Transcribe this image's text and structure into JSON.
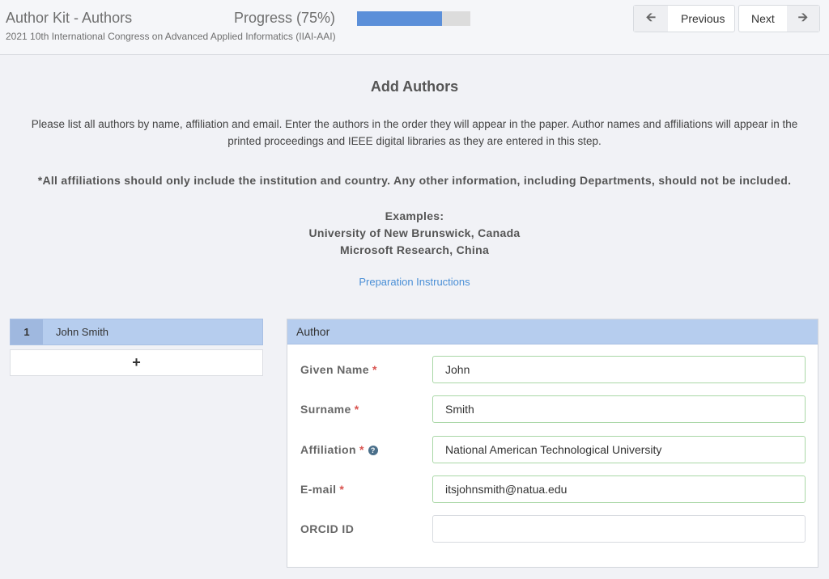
{
  "header": {
    "app_title": "Author Kit - Authors",
    "subtitle": "2021 10th International Congress on Advanced Applied Informatics (IIAI-AAI)",
    "progress_label": "Progress (75%)",
    "progress_value": 0.75,
    "progress_color": "#5b8fd9",
    "previous_label": "Previous",
    "previous_icon": "arrow-left-icon",
    "next_label": "Next",
    "next_icon": "arrow-right-icon"
  },
  "intro": {
    "title": "Add Authors",
    "text": "Please list all authors by name, affiliation and email. Enter the authors in the order they will appear in the paper. Author names and affiliations will appear in the printed proceedings and IEEE digital libraries as they are entered in this step.",
    "note": "*All affiliations should only include the institution and country. Any other information, including Departments, should not be included.",
    "examples_heading": "Examples:",
    "examples": [
      "University of New Brunswick, Canada",
      "Microsoft Research, China"
    ],
    "prep_link": "Preparation Instructions"
  },
  "authors": {
    "items": [
      {
        "number": "1",
        "name": "John Smith"
      }
    ],
    "add_label": "+"
  },
  "form": {
    "panel_title": "Author",
    "required_mark": "*",
    "help_icon": "question-circle-icon",
    "fields": [
      {
        "label": "Given Name",
        "value": "John",
        "required": true
      },
      {
        "label": "Surname",
        "value": "Smith",
        "required": true
      },
      {
        "label": "Affiliation",
        "value": "National American Technological University",
        "required": true,
        "help": true
      },
      {
        "label": "E-mail",
        "value": "itsjohnsmith@natua.edu",
        "required": true
      },
      {
        "label": "ORCID ID",
        "value": "",
        "required": false
      }
    ]
  },
  "colors": {
    "accent": "#5b8fd9",
    "selected_author": "#b6cdee",
    "required": "#d9534f",
    "valid_border": "#a9d7a6"
  }
}
